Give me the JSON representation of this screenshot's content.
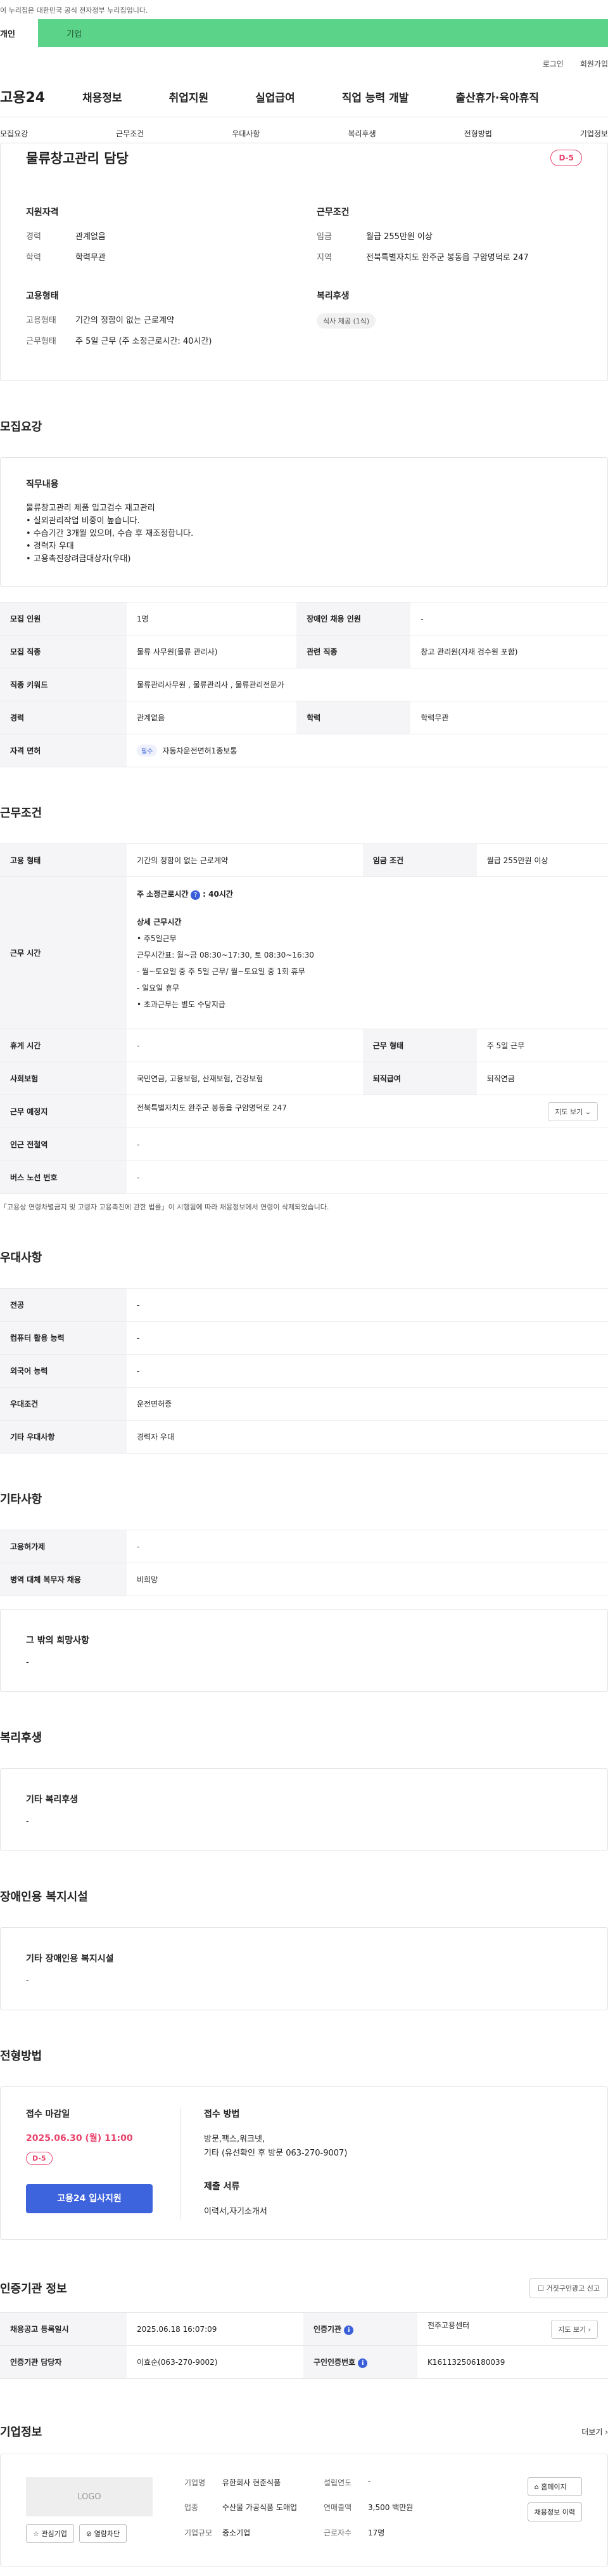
{
  "gov": {
    "notice": "이 누리집은 대한민국 공식 전자정부 누리집입니다.",
    "tab1": "개인",
    "tab2": "기업"
  },
  "util": {
    "login": "로그인",
    "join": "회원가입"
  },
  "gnb": {
    "logo": "고용24",
    "items": [
      "채용정보",
      "취업지원",
      "실업급여",
      "직업 능력 개발",
      "출산휴가·육아휴직"
    ]
  },
  "subnav": [
    "모집요강",
    "근무조건",
    "우대사항",
    "복리후생",
    "전형방법",
    "기업정보"
  ],
  "job": {
    "title": "물류창고관리 담당",
    "dday": "D-5",
    "qual_h": "지원자격",
    "cond_h": "근무조건",
    "qual": [
      {
        "k": "경력",
        "v": "관계없음"
      },
      {
        "k": "학력",
        "v": "학력무관"
      }
    ],
    "cond": [
      {
        "k": "임금",
        "v": "월급 255만원 이상"
      },
      {
        "k": "지역",
        "v": "전북특별자치도 완주군 봉동읍 구암명덕로 247"
      }
    ],
    "emp_h": "고용형태",
    "welf_h": "복리후생",
    "emp": [
      {
        "k": "고용형태",
        "v": "기간의 정함이 없는 근로계약"
      },
      {
        "k": "근무형태",
        "v": "주 5일 근무 (주 소정근로시간: 40시간)"
      }
    ],
    "welf_chip": "식사 제공 (1식)"
  },
  "recruit": {
    "title": "모집요강",
    "desc_h": "직무내용",
    "desc": [
      "물류창고관리 제품 입고검수 재고관리",
      "• 실외관리작업 비중이 높습니다.",
      "• 수습기간 3개월 있으며, 수습 후 재조정합니다.",
      "• 경력자 우대",
      "• 고용촉진장려금대상자(우대)"
    ],
    "rows": [
      {
        "k1": "모집 인원",
        "v1": "1명",
        "k2": "장애인 채용 인원",
        "v2": "-"
      },
      {
        "k1": "모집 직종",
        "v1": "물류 사무원(물류 관리사)",
        "k2": "관련 직종",
        "v2": "창고 관리원(자재 검수원 포함)"
      }
    ],
    "kw_k": "직종 키워드",
    "kw_v": "물류관리사무원 , 물류관리사 , 물류관리전문가",
    "car_k": "경력",
    "car_v": "관계없음",
    "edu_k": "학력",
    "edu_v": "학력무관",
    "lic_k": "자격 면허",
    "lic_tag": "필수",
    "lic_v": "자동차운전면허1종보통"
  },
  "work": {
    "title": "근무조건",
    "type_k": "고용 형태",
    "type_v": "기간의 정함이 없는 근로계약",
    "pay_k": "임금 조건",
    "pay_v": "월급 255만원 이상",
    "time_k": "근무 시간",
    "hours": "주 소정근로시간",
    "hours_v": ": 40시간",
    "detail_h": "상세 근무시간",
    "detail": [
      "• 주5일근무",
      "근무시간표: 월~금 08:30~17:30, 토 08:30~16:30",
      "- 월~토요일 중 주 5일 근무/ 월~토요일 중 1회 휴무",
      "- 일요일 휴무",
      "• 초과근무는 별도 수당지급"
    ],
    "leave_k": "휴게 시간",
    "leave_v": "-",
    "form_k": "근무 형태",
    "form_v": "주 5일 근무",
    "ins_k": "사회보험",
    "ins_v": "국민연금, 고용보험, 산재보험, 건강보험",
    "ret_k": "퇴직급여",
    "ret_v": "퇴직연금",
    "loc_k": "근무 예정지",
    "loc_v": "전북특별자치도 완주군 봉동읍 구암명덕로 247",
    "map_btn": "지도 보기",
    "sub_k": "인근 전철역",
    "sub_v": "-",
    "bus_k": "버스 노선 번호",
    "bus_v": "-",
    "note": "「고용상 연령차별금지 및 고령자 고용촉진에 관한 법률」이 시행됨에 따라 채용정보에서 연령이 삭제되었습니다."
  },
  "pref": {
    "title": "우대사항",
    "rows": [
      {
        "k": "전공",
        "v": "-"
      },
      {
        "k": "컴퓨터 활용 능력",
        "v": "-"
      },
      {
        "k": "외국어 능력",
        "v": "-"
      },
      {
        "k": "우대조건",
        "v": "운전면허증"
      },
      {
        "k": "기타 우대사항",
        "v": "경력자 우대"
      }
    ]
  },
  "etc": {
    "title": "기타사항",
    "rows": [
      {
        "k": "고용허가제",
        "v": "-"
      },
      {
        "k": "병역 대체 복무자 채용",
        "v": "비희망"
      }
    ],
    "wish_h": "그 밖의 희망사항",
    "wish_v": "-"
  },
  "benefit": {
    "title": "복리후생",
    "h": "기타 복리후생",
    "v": "-"
  },
  "disab": {
    "title": "장애인용 복지시설",
    "h": "기타 장애인용 복지시설",
    "v": "-"
  },
  "apply": {
    "title": "전형방법",
    "deadline_h": "접수 마감일",
    "deadline": "2025.06.30 (월) 11:00",
    "dday": "D-5",
    "btn": "고용24 입사지원",
    "method_h": "접수 방법",
    "method": [
      "방문,팩스,워크넷,",
      "기타 (유선확인 후 방문 063-270-9007)"
    ],
    "docs_h": "제출 서류",
    "docs": "이력서,자기소개서"
  },
  "cert": {
    "title": "인증기관 정보",
    "report": "거짓구인광고 신고",
    "reg_k": "채용공고 등록일시",
    "reg_v": "2025.06.18 16:07:09",
    "org_k": "인증기관",
    "org_v": "전주고용센터",
    "map_btn": "지도 보기",
    "mgr_k": "인증기관 담당자",
    "mgr_v": "이효순(063-270-9002)",
    "no_k": "구인인증번호",
    "no_v": "K161132506180039"
  },
  "company": {
    "title": "기업정보",
    "more": "더보기",
    "logo": "LOGO",
    "fav": "관심기업",
    "block": "열람차단",
    "name_k": "기업명",
    "name_v": "유한회사 현준식품",
    "ind_k": "업종",
    "ind_v": "수산물 가공식품 도매업",
    "size_k": "기업규모",
    "size_v": "중소기업",
    "year_k": "설립연도",
    "year_v": "-",
    "rev_k": "연매출액",
    "rev_v": "3,500 백만원",
    "emp_k": "근로자수",
    "emp_v": "17명",
    "home_btn": "홈페이지",
    "jobs_btn": "채용정보 이력"
  }
}
